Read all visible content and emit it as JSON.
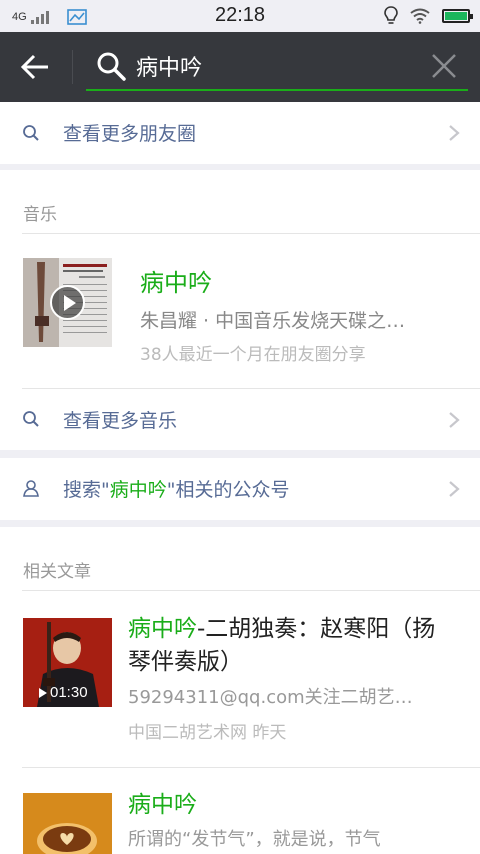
{
  "status": {
    "network": "4G",
    "time": "22:18"
  },
  "search": {
    "query": "病中吟"
  },
  "moments_more": {
    "label": "查看更多朋友圈"
  },
  "music": {
    "section_title": "音乐",
    "item": {
      "title": "病中吟",
      "subtitle": "朱昌耀 · 中国音乐发烧天碟之…",
      "share_count": "38人最近一个月在朋友圈分享"
    },
    "more_label": "查看更多音乐"
  },
  "official": {
    "prefix": "搜索\"",
    "keyword": "病中吟",
    "suffix": "\"相关的公众号"
  },
  "articles": {
    "section_title": "相关文章",
    "items": [
      {
        "title_highlight": "病中吟",
        "title_rest": "-二胡独奏：赵寒阳（扬琴伴奏版）",
        "desc": "59294311@qq.com关注二胡艺…",
        "meta": "中国二胡艺术网  昨天",
        "duration": "01:30"
      },
      {
        "title_highlight": "病中吟",
        "title_rest": "",
        "desc": "所谓的“发节气”，就是说，节气"
      }
    ]
  },
  "colors": {
    "header_bg": "#36383d",
    "accent_green": "#1aad19",
    "link_blue": "#576b95"
  }
}
